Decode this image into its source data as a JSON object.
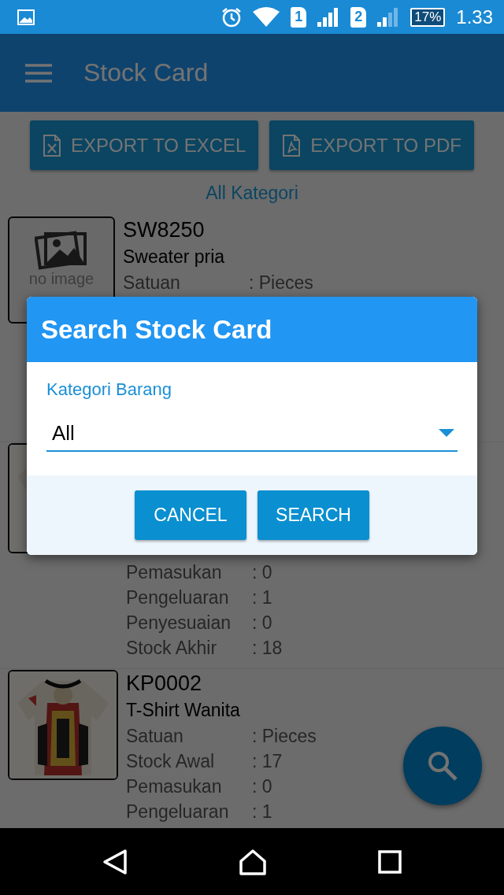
{
  "status_bar": {
    "sim_1": "1",
    "sim_2": "2",
    "battery": "17%",
    "time": "1.33"
  },
  "app_bar": {
    "title": "Stock Card"
  },
  "export_buttons": [
    {
      "kind": "excel",
      "label": "EXPORT TO EXCEL"
    },
    {
      "kind": "pdf",
      "label": "EXPORT TO PDF"
    }
  ],
  "category_filter": "All Kategori",
  "items": [
    {
      "code": "SW8250",
      "name": "Sweater pria",
      "image": {
        "kind": "placeholder",
        "text": "no image"
      },
      "fields": [
        {
          "label": "Satuan",
          "value": ": Pieces"
        }
      ]
    },
    {
      "fields": [
        {
          "label": "Pemasukan",
          "value": ": 0"
        },
        {
          "label": "Pengeluaran",
          "value": ": 1"
        },
        {
          "label": "Penyesuaian",
          "value": ": 0"
        },
        {
          "label": "Stock Akhir",
          "value": ": 18"
        }
      ]
    },
    {
      "code": "KP0002",
      "name": "T-Shirt Wanita",
      "fields": [
        {
          "label": "Satuan",
          "value": ": Pieces"
        },
        {
          "label": "Stock Awal",
          "value": ": 17"
        },
        {
          "label": "Pemasukan",
          "value": ": 0"
        },
        {
          "label": "Pengeluaran",
          "value": ": 1"
        }
      ]
    }
  ],
  "dialog": {
    "title": "Search Stock Card",
    "field_label": "Kategori Barang",
    "value": "All",
    "buttons": [
      "CANCEL",
      "SEARCH"
    ]
  }
}
